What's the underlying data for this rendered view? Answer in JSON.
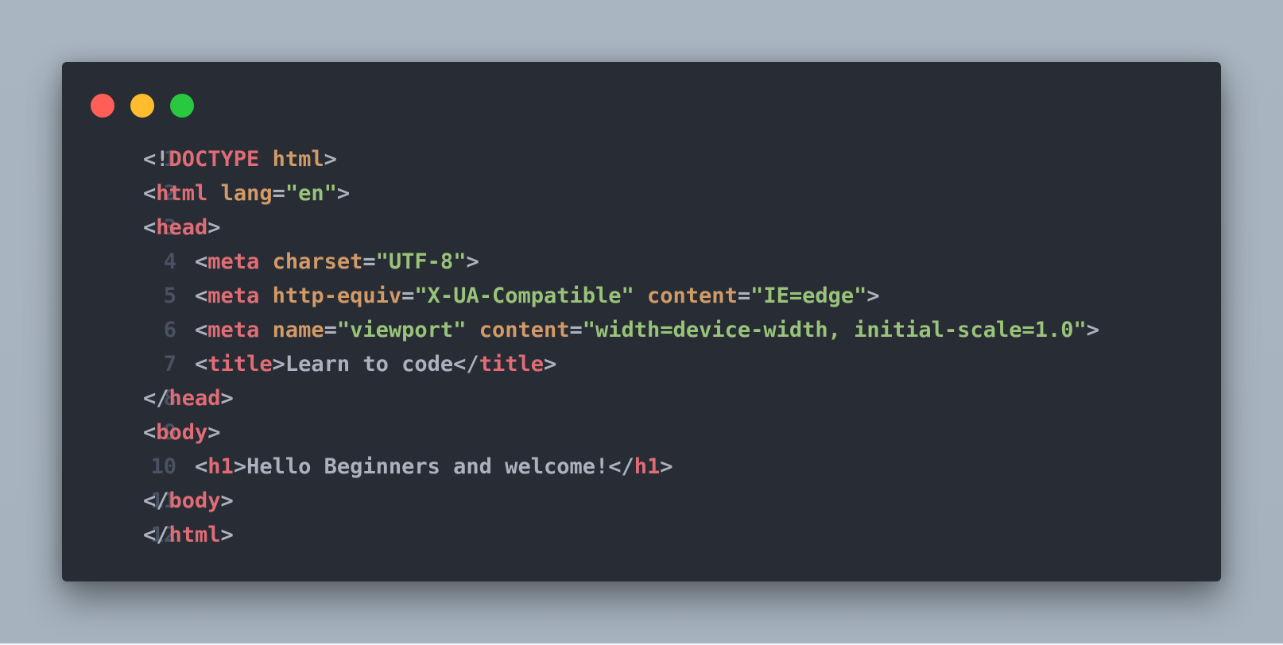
{
  "theme": {
    "background": "#a8b4c0",
    "window": "#282c34",
    "line_number": "#495162",
    "punctuation": "#abb2bf",
    "tag": "#e06c75",
    "attribute": "#d19a66",
    "string": "#98c379",
    "text": "#abb2bf"
  },
  "window_controls": [
    {
      "name": "close",
      "color": "#ff5f57"
    },
    {
      "name": "minimize",
      "color": "#febc2e"
    },
    {
      "name": "maximize",
      "color": "#28c840"
    }
  ],
  "lines": [
    {
      "number": "1",
      "indent": "",
      "tokens": [
        {
          "t": "punct",
          "v": "<!"
        },
        {
          "t": "tag",
          "v": "DOCTYPE"
        },
        {
          "t": "punct",
          "v": " "
        },
        {
          "t": "attr",
          "v": "html"
        },
        {
          "t": "punct",
          "v": ">"
        }
      ]
    },
    {
      "number": "2",
      "indent": "",
      "tokens": [
        {
          "t": "punct",
          "v": "<"
        },
        {
          "t": "tag",
          "v": "html"
        },
        {
          "t": "punct",
          "v": " "
        },
        {
          "t": "attr",
          "v": "lang"
        },
        {
          "t": "punct",
          "v": "="
        },
        {
          "t": "str",
          "v": "\"en\""
        },
        {
          "t": "punct",
          "v": ">"
        }
      ]
    },
    {
      "number": "3",
      "indent": "",
      "tokens": [
        {
          "t": "punct",
          "v": "<"
        },
        {
          "t": "tag",
          "v": "head"
        },
        {
          "t": "punct",
          "v": ">"
        }
      ]
    },
    {
      "number": "4",
      "indent": "    ",
      "tokens": [
        {
          "t": "punct",
          "v": "<"
        },
        {
          "t": "tag",
          "v": "meta"
        },
        {
          "t": "punct",
          "v": " "
        },
        {
          "t": "attr",
          "v": "charset"
        },
        {
          "t": "punct",
          "v": "="
        },
        {
          "t": "str",
          "v": "\"UTF-8\""
        },
        {
          "t": "punct",
          "v": ">"
        }
      ]
    },
    {
      "number": "5",
      "indent": "    ",
      "tokens": [
        {
          "t": "punct",
          "v": "<"
        },
        {
          "t": "tag",
          "v": "meta"
        },
        {
          "t": "punct",
          "v": " "
        },
        {
          "t": "attr",
          "v": "http-equiv"
        },
        {
          "t": "punct",
          "v": "="
        },
        {
          "t": "str",
          "v": "\"X-UA-Compatible\""
        },
        {
          "t": "punct",
          "v": " "
        },
        {
          "t": "attr",
          "v": "content"
        },
        {
          "t": "punct",
          "v": "="
        },
        {
          "t": "str",
          "v": "\"IE=edge\""
        },
        {
          "t": "punct",
          "v": ">"
        }
      ]
    },
    {
      "number": "6",
      "indent": "    ",
      "tokens": [
        {
          "t": "punct",
          "v": "<"
        },
        {
          "t": "tag",
          "v": "meta"
        },
        {
          "t": "punct",
          "v": " "
        },
        {
          "t": "attr",
          "v": "name"
        },
        {
          "t": "punct",
          "v": "="
        },
        {
          "t": "str",
          "v": "\"viewport\""
        },
        {
          "t": "punct",
          "v": " "
        },
        {
          "t": "attr",
          "v": "content"
        },
        {
          "t": "punct",
          "v": "="
        },
        {
          "t": "str",
          "v": "\"width=device-width, initial-scale=1.0\""
        },
        {
          "t": "punct",
          "v": ">"
        }
      ]
    },
    {
      "number": "7",
      "indent": "    ",
      "tokens": [
        {
          "t": "punct",
          "v": "<"
        },
        {
          "t": "tag",
          "v": "title"
        },
        {
          "t": "punct",
          "v": ">"
        },
        {
          "t": "text",
          "v": "Learn to code"
        },
        {
          "t": "punct",
          "v": "</"
        },
        {
          "t": "tag",
          "v": "title"
        },
        {
          "t": "punct",
          "v": ">"
        }
      ]
    },
    {
      "number": "8",
      "indent": "",
      "tokens": [
        {
          "t": "punct",
          "v": "</"
        },
        {
          "t": "tag",
          "v": "head"
        },
        {
          "t": "punct",
          "v": ">"
        }
      ]
    },
    {
      "number": "9",
      "indent": "",
      "tokens": [
        {
          "t": "punct",
          "v": "<"
        },
        {
          "t": "tag",
          "v": "body"
        },
        {
          "t": "punct",
          "v": ">"
        }
      ]
    },
    {
      "number": "10",
      "indent": "    ",
      "tokens": [
        {
          "t": "punct",
          "v": "<"
        },
        {
          "t": "tag",
          "v": "h1"
        },
        {
          "t": "punct",
          "v": ">"
        },
        {
          "t": "text",
          "v": "Hello Beginners and welcome!"
        },
        {
          "t": "punct",
          "v": "</"
        },
        {
          "t": "tag",
          "v": "h1"
        },
        {
          "t": "punct",
          "v": ">"
        }
      ]
    },
    {
      "number": "11",
      "indent": "",
      "tokens": [
        {
          "t": "punct",
          "v": "</"
        },
        {
          "t": "tag",
          "v": "body"
        },
        {
          "t": "punct",
          "v": ">"
        }
      ]
    },
    {
      "number": "12",
      "indent": "",
      "tokens": [
        {
          "t": "punct",
          "v": "</"
        },
        {
          "t": "tag",
          "v": "html"
        },
        {
          "t": "punct",
          "v": ">"
        }
      ]
    }
  ]
}
